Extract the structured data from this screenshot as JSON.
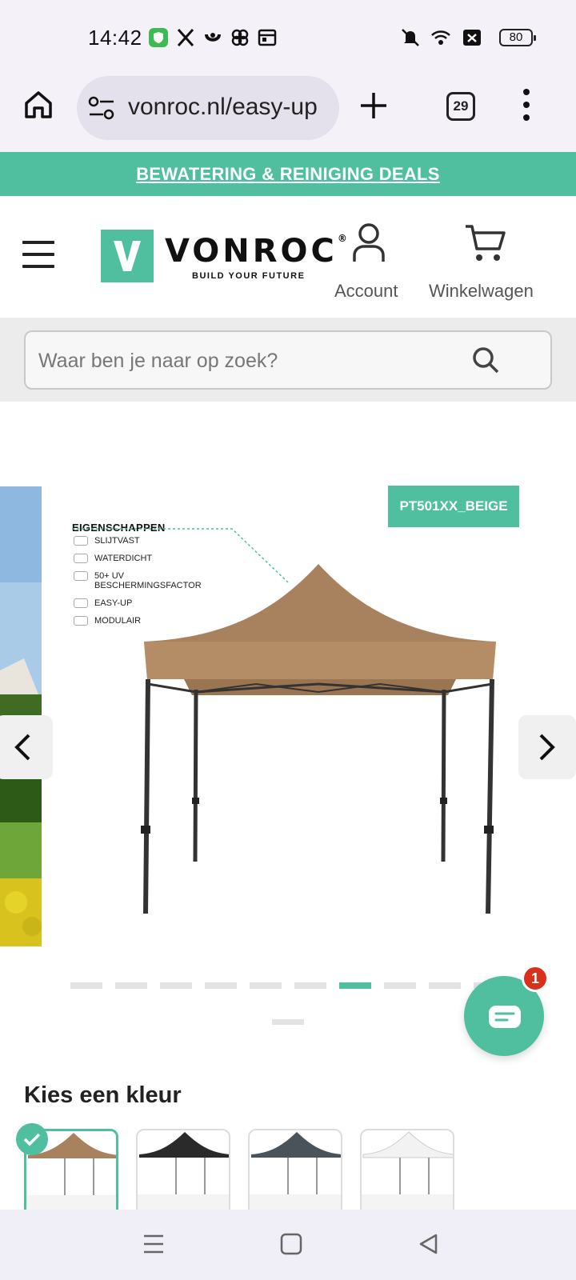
{
  "status_bar": {
    "time": "14:42",
    "battery": "80",
    "icons": [
      "shield-app-icon",
      "x-app-icon",
      "app-icon",
      "pinwheel-icon",
      "calendar-icon",
      "mute-icon",
      "wifi-icon",
      "x-box-icon",
      "battery-icon"
    ]
  },
  "browser": {
    "url": "vonroc.nl/easy-up",
    "tab_count": "29"
  },
  "promo_banner": {
    "text": "BEWATERING & REINIGING DEALS",
    "color": "#4fbf9f"
  },
  "header": {
    "brand": "VONROC",
    "registered": "®",
    "tagline": "BUILD YOUR FUTURE",
    "account_label": "Account",
    "cart_label": "Winkelwagen"
  },
  "search": {
    "placeholder": "Waar ben je naar op zoek?"
  },
  "gallery": {
    "sku": "PT501XX_BEIGE",
    "properties_title": "EIGENSCHAPPEN",
    "properties": [
      "SLIJTVAST",
      "WATERDICHT",
      "50+ UV",
      "BESCHERMINGSFACTOR",
      "EASY-UP",
      "MODULAIR"
    ],
    "dot_count": 10,
    "active_dot": 7
  },
  "chat": {
    "badge": "1"
  },
  "color_picker": {
    "title": "Kies een kleur",
    "swatches": [
      {
        "name": "beige",
        "color": "#a8825e",
        "selected": true
      },
      {
        "name": "black",
        "color": "#2a2a2a",
        "selected": false
      },
      {
        "name": "grey",
        "color": "#4a535a",
        "selected": false
      },
      {
        "name": "white",
        "color": "#f2f2f2",
        "selected": false
      }
    ]
  },
  "colors": {
    "accent": "#4fbf9f",
    "badge": "#d8311b"
  }
}
